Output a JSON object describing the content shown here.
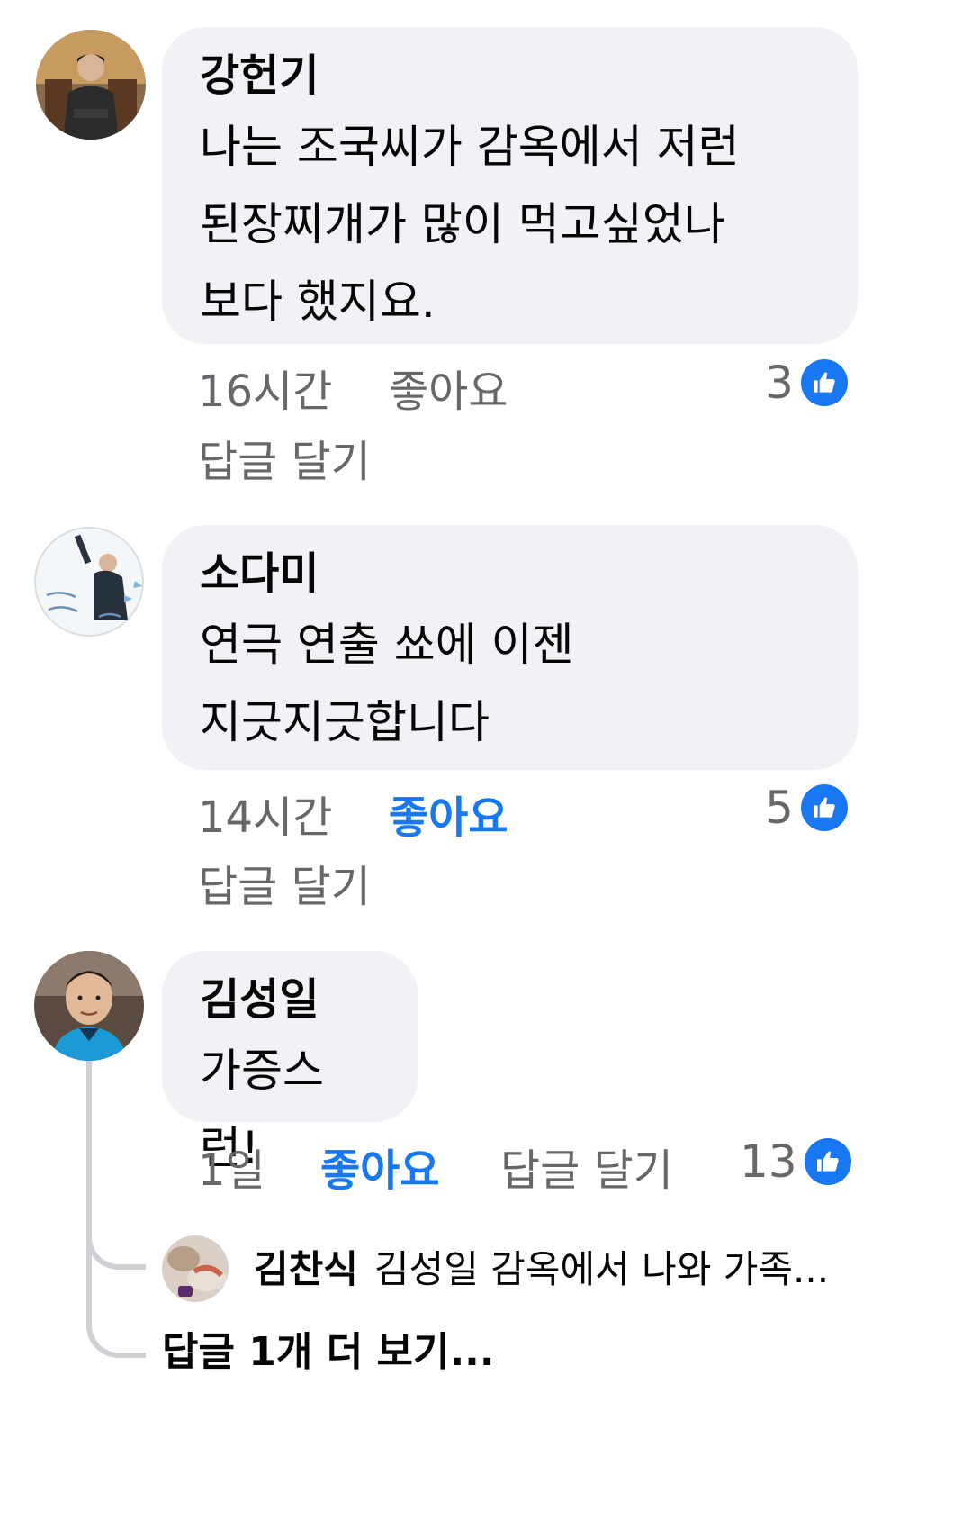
{
  "comments": [
    {
      "author": "강헌기",
      "text": "나는 조국씨가 감옥에서 저런\n된장찌개가 많이 먹고싶었나\n보다 했지요.",
      "time": "16시간",
      "like_label": "좋아요",
      "reply_label": "답글 달기",
      "reaction_count": "3",
      "liked": false
    },
    {
      "author": "소다미",
      "text": "연극 연출 쑈에 이젠\n지긋지긋합니다",
      "time": "14시간",
      "like_label": "좋아요",
      "reply_label": "답글 달기",
      "reaction_count": "5",
      "liked": true
    },
    {
      "author": "김성일",
      "text": "가증스런!",
      "time": "1일",
      "like_label": "좋아요",
      "reply_label": "답글 달기",
      "reaction_count": "13",
      "liked": true
    }
  ],
  "reply_preview": {
    "author": "김찬식",
    "text": "김성일 감옥에서 나와 가족..."
  },
  "more_replies_label": "답글 1개 더 보기...",
  "colors": {
    "bubble": "#f0f2f5",
    "meta": "#65676b",
    "accent": "#1877f2",
    "thread": "#ced0d4"
  },
  "icons": {
    "reaction": "like-thumb-icon"
  }
}
